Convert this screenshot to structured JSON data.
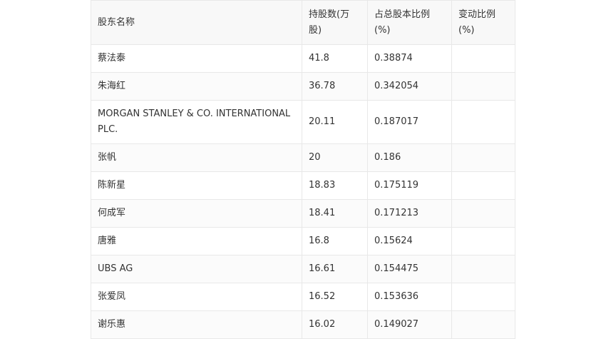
{
  "table": {
    "headers": [
      "股东名称",
      "持股数(万股)",
      "占总股本比例(%)",
      "变动比例(%)"
    ],
    "rows": [
      [
        "蔡法泰",
        "41.8",
        "0.38874",
        ""
      ],
      [
        "朱海红",
        "36.78",
        "0.342054",
        ""
      ],
      [
        "MORGAN STANLEY & CO. INTERNATIONAL PLC.",
        "20.11",
        "0.187017",
        ""
      ],
      [
        "张帆",
        "20",
        "0.186",
        ""
      ],
      [
        "陈新星",
        "18.83",
        "0.175119",
        ""
      ],
      [
        "何成军",
        "18.41",
        "0.171213",
        ""
      ],
      [
        "唐雅",
        "16.8",
        "0.15624",
        ""
      ],
      [
        "UBS AG",
        "16.61",
        "0.154475",
        ""
      ],
      [
        "张爱凤",
        "16.52",
        "0.153636",
        ""
      ],
      [
        "谢乐惠",
        "16.02",
        "0.149027",
        ""
      ]
    ]
  }
}
